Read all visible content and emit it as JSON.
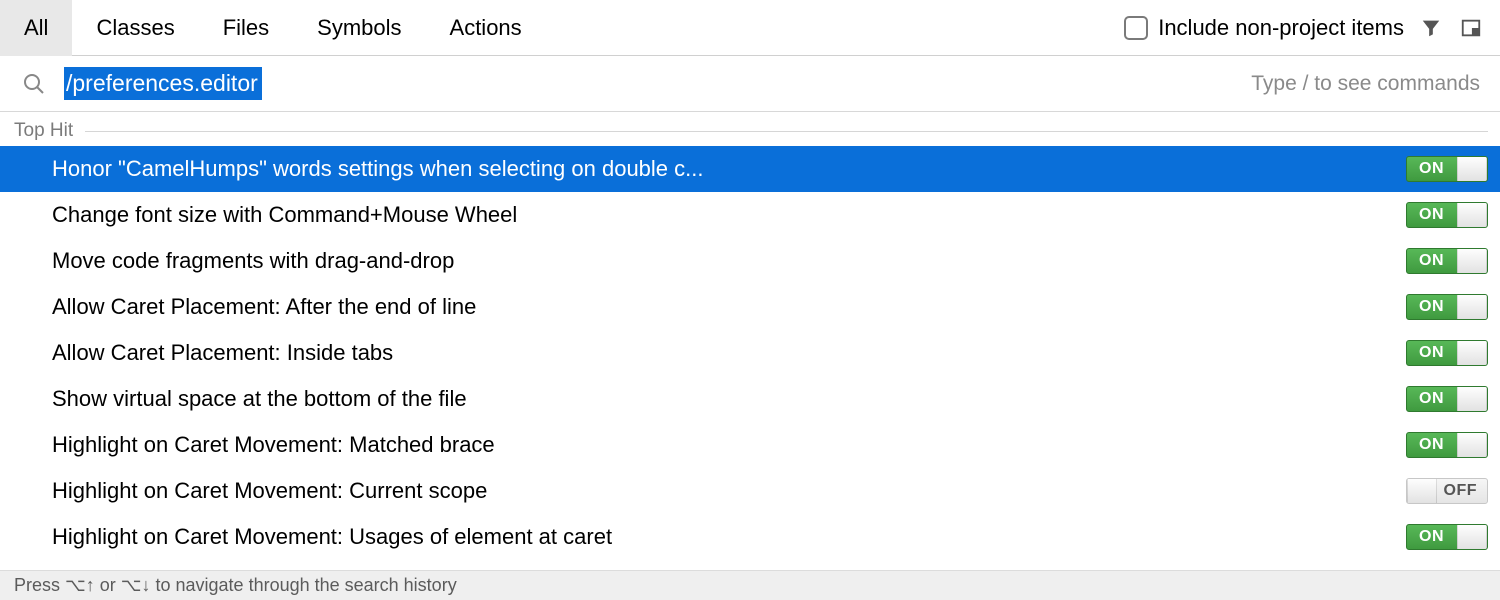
{
  "tabs": [
    {
      "label": "All",
      "active": true
    },
    {
      "label": "Classes",
      "active": false
    },
    {
      "label": "Files",
      "active": false
    },
    {
      "label": "Symbols",
      "active": false
    },
    {
      "label": "Actions",
      "active": false
    }
  ],
  "includeNonProject": {
    "label": "Include non-project items",
    "checked": false
  },
  "search": {
    "value": "/preferences.editor",
    "hint": "Type / to see commands"
  },
  "sectionHeader": "Top Hit",
  "results": [
    {
      "label": "Honor \"CamelHumps\" words settings when selecting on double c...",
      "state": "ON",
      "selected": true
    },
    {
      "label": "Change font size with Command+Mouse Wheel",
      "state": "ON",
      "selected": false
    },
    {
      "label": "Move code fragments with drag-and-drop",
      "state": "ON",
      "selected": false
    },
    {
      "label": "Allow Caret Placement: After the end of line",
      "state": "ON",
      "selected": false
    },
    {
      "label": "Allow Caret Placement: Inside tabs",
      "state": "ON",
      "selected": false
    },
    {
      "label": "Show virtual space at the bottom of the file",
      "state": "ON",
      "selected": false
    },
    {
      "label": "Highlight on Caret Movement: Matched brace",
      "state": "ON",
      "selected": false
    },
    {
      "label": "Highlight on Caret Movement: Current scope",
      "state": "OFF",
      "selected": false
    },
    {
      "label": "Highlight on Caret Movement: Usages of element at caret",
      "state": "ON",
      "selected": false
    }
  ],
  "status": "Press ⌥↑ or ⌥↓ to navigate through the search history"
}
